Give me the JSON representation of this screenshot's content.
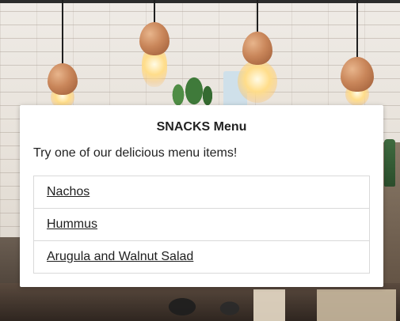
{
  "modal": {
    "title": "SNACKS Menu",
    "description": "Try one of our delicious menu items!",
    "items": [
      {
        "label": "Nachos"
      },
      {
        "label": "Hummus"
      },
      {
        "label": "Arugula and Walnut Salad"
      }
    ]
  },
  "colors": {
    "modal_background": "#ffffff",
    "text": "#222222",
    "border": "#d9d9d9",
    "link": "#1e1e1e"
  }
}
